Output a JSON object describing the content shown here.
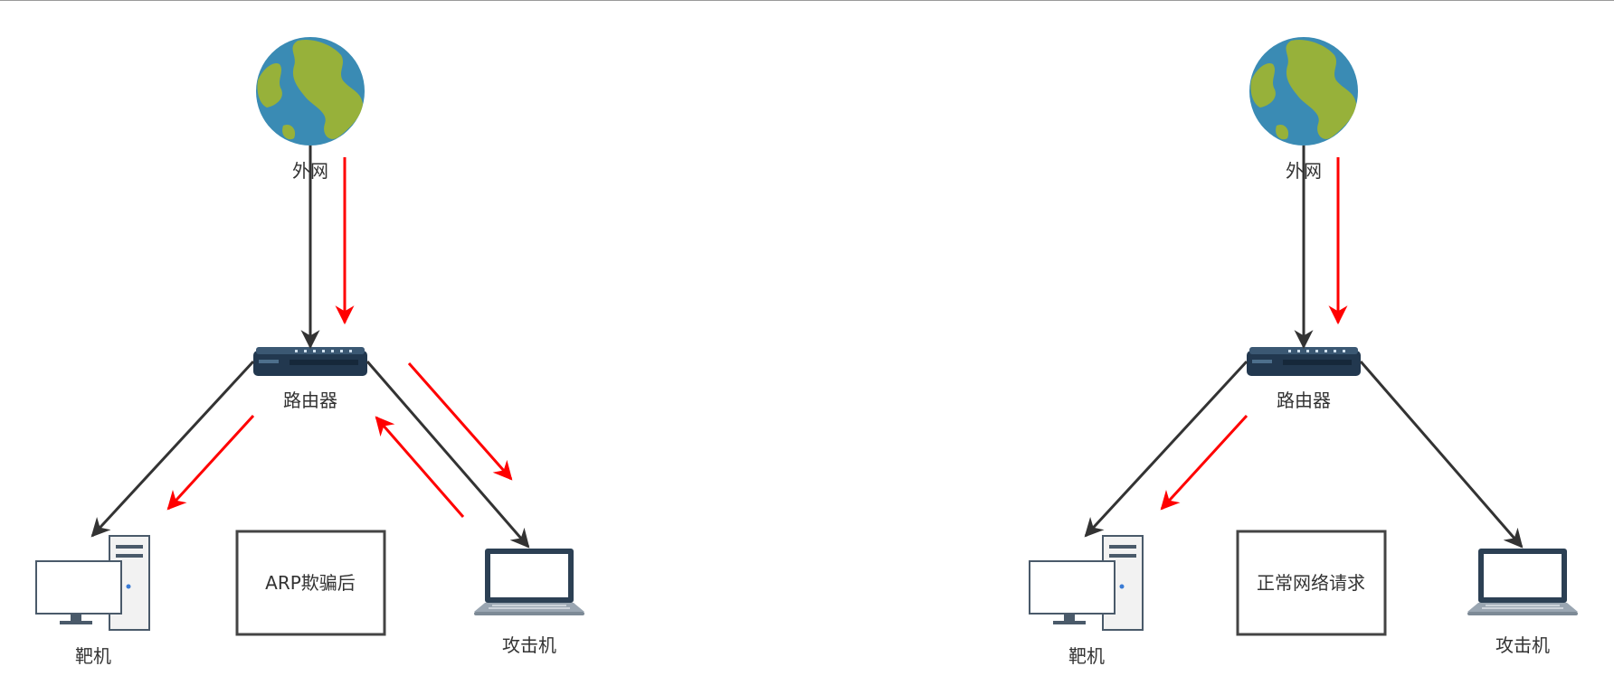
{
  "diagrams": [
    {
      "id": "arp-spoofed",
      "nodes": {
        "internet": "外网",
        "router": "路由器",
        "target": "靶机",
        "attacker": "攻击机"
      },
      "box_label": "ARP欺骗后"
    },
    {
      "id": "normal",
      "nodes": {
        "internet": "外网",
        "router": "路由器",
        "target": "靶机",
        "attacker": "攻击机"
      },
      "box_label": "正常网络请求"
    }
  ],
  "colors": {
    "link": "#333333",
    "flow": "#ff0000",
    "ocean": "#3a8bb4",
    "land": "#97b13a",
    "router": "#22384f",
    "screen": "#2c4054"
  },
  "icons": {
    "internet": "globe-icon",
    "router": "router-icon",
    "target": "desktop-computer-icon",
    "attacker": "laptop-icon"
  }
}
